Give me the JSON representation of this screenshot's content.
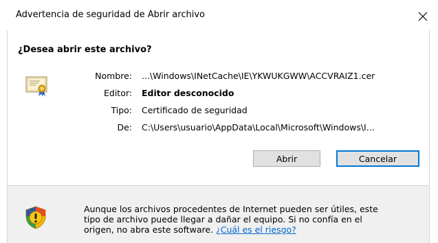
{
  "window": {
    "title": "Advertencia de seguridad de Abrir archivo"
  },
  "dialog": {
    "question": "¿Desea abrir este archivo?",
    "fields": [
      {
        "label": "Nombre:",
        "value": "...\\Windows\\INetCache\\IE\\YKWUKGWW\\ACCVRAIZ1.cer"
      },
      {
        "label": "Editor:",
        "value": "Editor desconocido"
      },
      {
        "label": "Tipo:",
        "value": "Certificado de seguridad"
      },
      {
        "label": "De:",
        "value": "C:\\Users\\usuario\\AppData\\Local\\Microsoft\\Windows\\I..."
      }
    ]
  },
  "buttons": {
    "open": "Abrir",
    "cancel": "Cancelar"
  },
  "footer": {
    "warning_line1": "Aunque los archivos procedentes de Internet pueden ser útiles, este",
    "warning_line2": "tipo de archivo puede llegar a dañar el equipo. Si no confía en el",
    "warning_line3": "origen, no abra este software.",
    "risk_link": "¿Cuál es el riesgo?"
  },
  "colors": {
    "accent": "#0078d7",
    "link": "#0066cc",
    "footer_bg": "#f0f0f0",
    "button_bg": "#e1e1e1"
  },
  "icons": {
    "close": "close-icon",
    "certificate": "certificate-icon",
    "shield": "shield-warning-icon"
  }
}
